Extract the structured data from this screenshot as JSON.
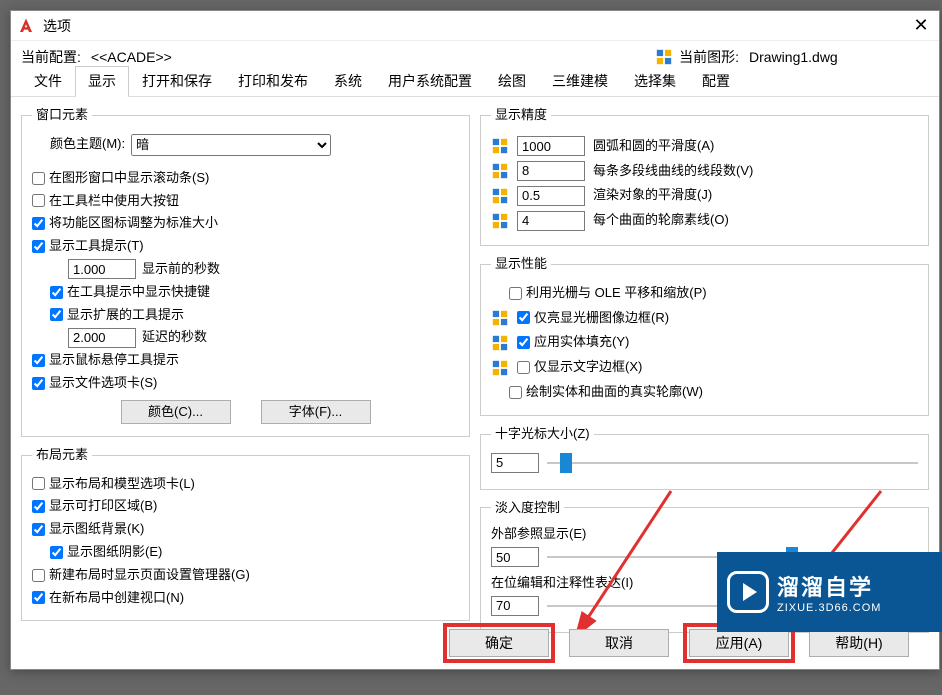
{
  "titlebar": {
    "title": "选项"
  },
  "profilebar": {
    "profile_label": "当前配置:",
    "profile_value": "<<ACADE>>",
    "drawing_label": "当前图形:",
    "drawing_value": "Drawing1.dwg"
  },
  "tabs": {
    "items": [
      {
        "label": "文件"
      },
      {
        "label": "显示"
      },
      {
        "label": "打开和保存"
      },
      {
        "label": "打印和发布"
      },
      {
        "label": "系统"
      },
      {
        "label": "用户系统配置"
      },
      {
        "label": "绘图"
      },
      {
        "label": "三维建模"
      },
      {
        "label": "选择集"
      },
      {
        "label": "配置"
      }
    ],
    "active_index": 1
  },
  "window_elements": {
    "legend": "窗口元素",
    "color_theme_label": "颜色主题(M):",
    "color_theme_value": "暗",
    "show_scrollbars": "在图形窗口中显示滚动条(S)",
    "large_toolbar": "在工具栏中使用大按钮",
    "resize_ribbon": "将功能区图标调整为标准大小",
    "show_tooltips": "显示工具提示(T)",
    "seconds_before": "1.000",
    "seconds_before_label": "显示前的秒数",
    "show_shortcuts": "在工具提示中显示快捷键",
    "show_ext_tooltips": "显示扩展的工具提示",
    "delay_seconds": "2.000",
    "delay_seconds_label": "延迟的秒数",
    "show_rollover": "显示鼠标悬停工具提示",
    "show_file_tabs": "显示文件选项卡(S)",
    "colors_btn": "颜色(C)...",
    "fonts_btn": "字体(F)..."
  },
  "layout_elements": {
    "legend": "布局元素",
    "show_tabs": "显示布局和模型选项卡(L)",
    "show_printable": "显示可打印区域(B)",
    "show_paper_bg": "显示图纸背景(K)",
    "show_paper_shadow": "显示图纸阴影(E)",
    "show_pagesetup": "新建布局时显示页面设置管理器(G)",
    "create_viewport": "在新布局中创建视口(N)"
  },
  "display_precision": {
    "legend": "显示精度",
    "arc_value": "1000",
    "arc_label": "圆弧和圆的平滑度(A)",
    "pline_value": "8",
    "pline_label": "每条多段线曲线的线段数(V)",
    "render_value": "0.5",
    "render_label": "渲染对象的平滑度(J)",
    "surf_value": "4",
    "surf_label": "每个曲面的轮廓素线(O)"
  },
  "display_perf": {
    "legend": "显示性能",
    "raster_pan": "利用光栅与 OLE 平移和缩放(P)",
    "highlight_raster": "仅亮显光栅图像边框(R)",
    "apply_solid_fill": "应用实体填充(Y)",
    "text_frame": "仅显示文字边框(X)",
    "true_silh": "绘制实体和曲面的真实轮廓(W)"
  },
  "crosshair": {
    "legend": "十字光标大小(Z)",
    "value": "5",
    "pos_pct": 5
  },
  "fade": {
    "legend": "淡入度控制",
    "xref_label": "外部参照显示(E)",
    "xref_value": "50",
    "xref_pos_pct": 66,
    "inplace_label": "在位编辑和注释性表达(I)",
    "inplace_value": "70",
    "inplace_pos_pct": 80
  },
  "footer": {
    "ok": "确定",
    "cancel": "取消",
    "apply": "应用(A)",
    "help": "帮助(H)"
  },
  "watermark": {
    "big": "溜溜自学",
    "small": "ZIXUE.3D66.COM"
  }
}
